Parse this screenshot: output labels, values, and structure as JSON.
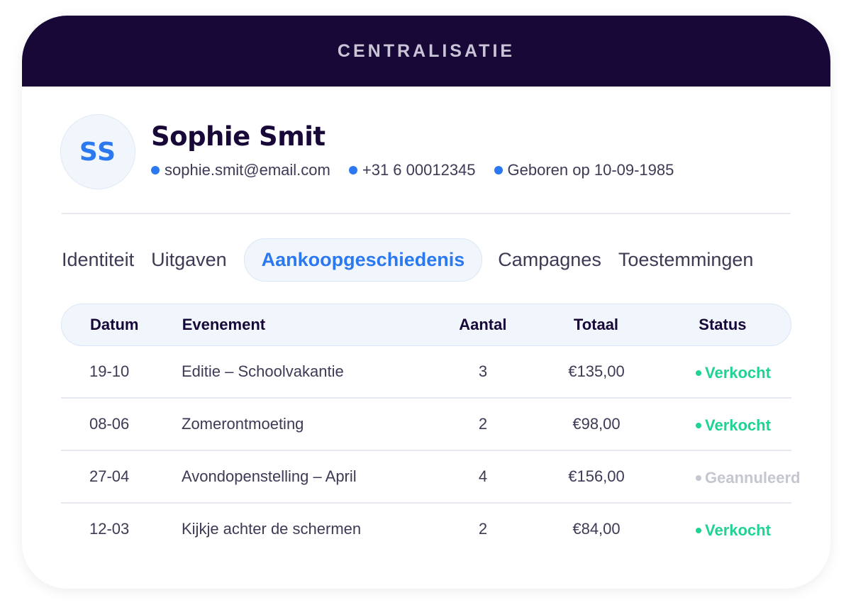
{
  "header": {
    "title": "CENTRALISATIE"
  },
  "profile": {
    "initials": "SS",
    "name": "Sophie Smit",
    "email": "sophie.smit@email.com",
    "phone": "+31 6 00012345",
    "birth": "Geboren op 10-09-1985"
  },
  "tabs": [
    {
      "label": "Identiteit",
      "active": false
    },
    {
      "label": "Uitgaven",
      "active": false
    },
    {
      "label": "Aankoopgeschiedenis",
      "active": true
    },
    {
      "label": "Campagnes",
      "active": false
    },
    {
      "label": "Toestemmingen",
      "active": false
    }
  ],
  "table": {
    "columns": [
      "Datum",
      "Evenement",
      "Aantal",
      "Totaal",
      "Status"
    ],
    "rows": [
      {
        "date": "19-10",
        "event": "Editie – Schoolvakantie",
        "amount": "3",
        "total": "€135,00",
        "status": "Verkocht",
        "status_color": "#1fd392"
      },
      {
        "date": "08-06",
        "event": "Zomerontmoeting",
        "amount": "2",
        "total": "€98,00",
        "status": "Verkocht",
        "status_color": "#1fd392"
      },
      {
        "date": "27-04",
        "event": "Avondopenstelling – April",
        "amount": "4",
        "total": "€156,00",
        "status": "Geannuleerd",
        "status_color": "#c4c6d0"
      },
      {
        "date": "12-03",
        "event": "Kijkje achter de schermen",
        "amount": "2",
        "total": "€84,00",
        "status": "Verkocht",
        "status_color": "#1fd392"
      }
    ]
  },
  "colors": {
    "header_bg": "#170838",
    "accent": "#2b78f0",
    "sold": "#1fd392",
    "cancelled": "#c4c6d0"
  }
}
